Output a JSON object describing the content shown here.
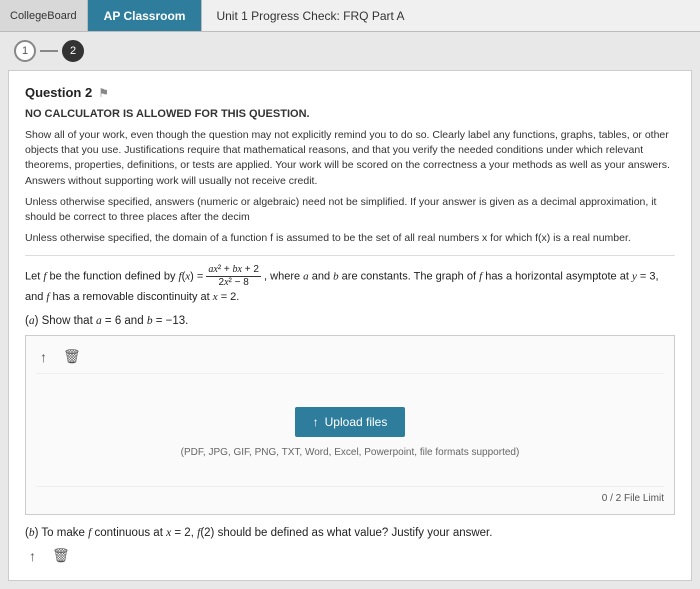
{
  "topbar": {
    "college_board_label": "CollegeBoard",
    "ap_tab_label": "AP Classroom",
    "unit_tab_label": "Unit 1 Progress Check: FRQ Part A"
  },
  "steps": {
    "step1_label": "1",
    "step2_label": "2"
  },
  "question": {
    "title": "Question 2",
    "no_calc_notice": "NO CALCULATOR IS ALLOWED FOR THIS QUESTION.",
    "instruction1": "Show all of your work, even though the question may not explicitly remind you to do so. Clearly label any functions, graphs, tables, or other objects that you use. Justifications require that mathematical reasons, and that you verify the needed conditions under which relevant theorems, properties, definitions, or tests are applied. Your work will be scored on the correctness a your methods as well as your answers. Answers without supporting work will usually not receive credit.",
    "instruction2": "Unless otherwise specified, answers (numeric or algebraic) need not be simplified. If your answer is given as a decimal approximation, it should be correct to three places after the decim",
    "instruction3": "Unless otherwise specified, the domain of a function f is assumed to be the set of all real numbers x for which f(x) is a real number.",
    "function_definition": "Let f be the function defined by f(x) = (ax² + bx + 2) / (2x² - 8), where a and b are constants. The graph of f has a horizontal asymptote at y = 3, and f has a removable discontinuity at x = 2.",
    "part_a_label": "(a) Show that a = 6 and b = −13.",
    "part_b_label": "(b) To make f continuous at x = 2, f(2) should be defined as what value? Justify your answer."
  },
  "upload": {
    "button_label": "Upload files",
    "upload_icon": "↑",
    "formats_text": "(PDF, JPG, GIF, PNG, TXT, Word, Excel, Powerpoint, file formats supported)",
    "file_limit_text": "0 / 2 File Limit"
  },
  "toolbar": {
    "upload_icon_label": "↑",
    "trash_icon_label": "🗑"
  }
}
